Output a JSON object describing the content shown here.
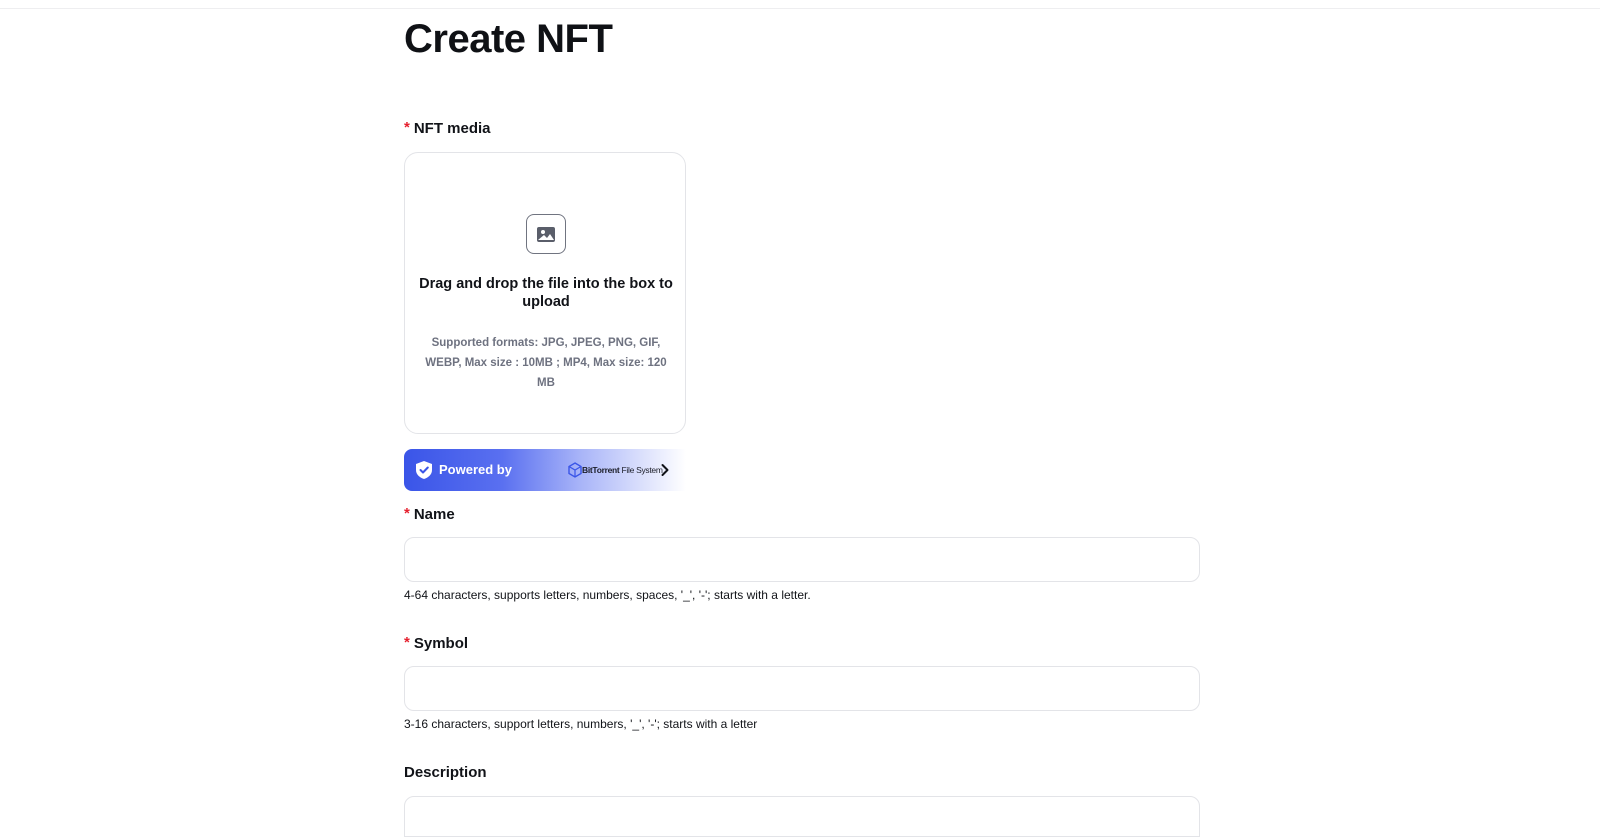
{
  "page": {
    "title": "Create NFT"
  },
  "media": {
    "label": "NFT media",
    "required_mark": "*",
    "drop_text": "Drag and drop the file into the box to upload",
    "formats_text": "Supported formats: JPG, JPEG, PNG, GIF, WEBP, Max size : 10MB ; MP4, Max size: 120 MB",
    "icon": "image-icon"
  },
  "powered_by": {
    "label": "Powered by",
    "brand_bold": "BitTorrent",
    "brand_rest": " File System",
    "icon": "shield-check-icon",
    "chevron_icon": "chevron-right-icon"
  },
  "name_field": {
    "label": "Name",
    "required_mark": "*",
    "value": "",
    "hint": "4-64 characters, supports letters, numbers, spaces, '_', '-'; starts with a letter."
  },
  "symbol_field": {
    "label": "Symbol",
    "required_mark": "*",
    "value": "",
    "hint": "3-16 characters, support letters, numbers, '_', '-'; starts with a letter"
  },
  "description_field": {
    "label": "Description",
    "value": ""
  },
  "colors": {
    "required": "#e5202e",
    "brand_blue": "#3a55e8",
    "border": "#e3e4e8"
  }
}
